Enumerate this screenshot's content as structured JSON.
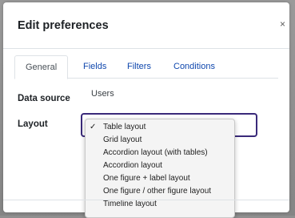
{
  "modal": {
    "title": "Edit preferences",
    "close_glyph": "×"
  },
  "tabs": [
    {
      "label": "General",
      "active": true
    },
    {
      "label": "Fields",
      "active": false
    },
    {
      "label": "Filters",
      "active": false
    },
    {
      "label": "Conditions",
      "active": false
    }
  ],
  "form": {
    "data_source_label": "Data source",
    "data_source_value": "Users",
    "layout_label": "Layout"
  },
  "layout_select": {
    "selected": "Table layout",
    "check_glyph": "✓",
    "options": [
      "Table layout",
      "Grid layout",
      "Accordion layout (with tables)",
      "Accordion layout",
      "One figure + label layout",
      "One figure / other figure layout",
      "Timeline layout"
    ]
  },
  "colors": {
    "tab_link": "#0f47ad",
    "select_border": "#3a2a7a"
  }
}
